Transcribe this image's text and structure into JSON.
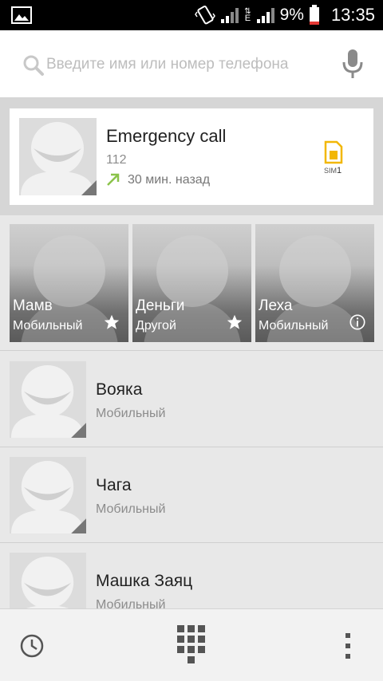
{
  "status_bar": {
    "battery_percent": "9%",
    "network_type": "E",
    "time": "13:35",
    "icons": [
      "gallery-icon",
      "vibrate-icon",
      "signal-icon",
      "data-arrows-icon",
      "signal-icon",
      "battery-icon"
    ]
  },
  "search": {
    "placeholder": "Введите имя или номер телефона",
    "icons": [
      "search-icon",
      "microphone-icon"
    ]
  },
  "recent_call": {
    "name": "Emergency call",
    "number": "112",
    "time_ago": "30 мин. назад",
    "sim_label": "SIM",
    "sim_number": "1",
    "icons": [
      "outgoing-call-arrow-icon",
      "sim-card-icon"
    ],
    "colors": {
      "arrow": "#8bc34a",
      "sim": "#f2b705"
    }
  },
  "favorites": [
    {
      "name": "Мамв",
      "type": "Мобильный",
      "action_icon": "star-icon"
    },
    {
      "name": "Деньги",
      "type": "Другой",
      "action_icon": "star-icon"
    },
    {
      "name": "Леха",
      "type": "Мобильный",
      "action_icon": "info-icon"
    }
  ],
  "contacts": [
    {
      "name": "Вояка",
      "type": "Мобильный"
    },
    {
      "name": "Чага",
      "type": "Мобильный"
    },
    {
      "name": "Машка Заяц",
      "type": "Мобильный"
    }
  ],
  "bottom_bar": {
    "icons": [
      "history-icon",
      "dialpad-icon",
      "overflow-menu-icon"
    ]
  }
}
